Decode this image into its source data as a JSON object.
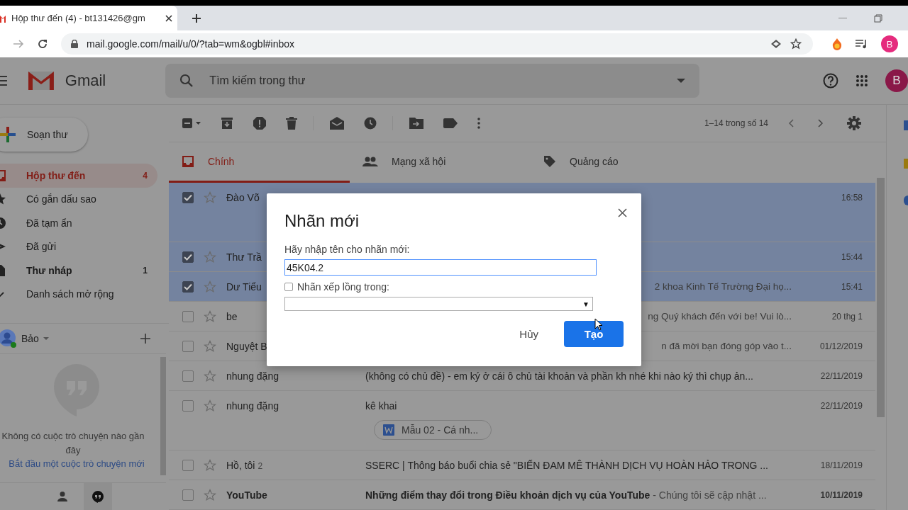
{
  "browser": {
    "tab_title": "Hộp thư đến (4) - bt131426@gm",
    "url": "mail.google.com/mail/u/0/?tab=wm&ogbl#inbox",
    "profile_initial": "B"
  },
  "header": {
    "app_name": "Gmail",
    "search_placeholder": "Tìm kiếm trong thư",
    "avatar_initial": "B"
  },
  "sidebar": {
    "compose": "Soạn thư",
    "items": [
      {
        "kind": "inbox",
        "label": "Hộp thư đến",
        "count": "4",
        "selected": true,
        "unread": true
      },
      {
        "kind": "star",
        "label": "Có gắn dấu sao",
        "selected": false,
        "unread": false
      },
      {
        "kind": "clock",
        "label": "Đã tạm ẩn",
        "selected": false,
        "unread": false
      },
      {
        "kind": "send",
        "label": "Đã gửi",
        "selected": false,
        "unread": false
      },
      {
        "kind": "draft",
        "label": "Thư nháp",
        "count": "1",
        "selected": false,
        "unread": true
      },
      {
        "kind": "more",
        "label": "Danh sách mở rộng",
        "selected": false,
        "unread": false
      }
    ],
    "hangouts": {
      "user": "Bảo",
      "online": true,
      "empty_text": "Không có cuộc trò chuyện nào gần đây",
      "start_link": "Bắt đầu một cuộc trò chuyện mới"
    }
  },
  "toolbar": {
    "pagination": "1–14 trong số 14"
  },
  "tabs": [
    {
      "kind": "inbox",
      "label": "Chính",
      "selected": true
    },
    {
      "kind": "people",
      "label": "Mạng xã hội",
      "selected": false
    },
    {
      "kind": "tag",
      "label": "Quảng cáo",
      "selected": false
    }
  ],
  "rows": [
    {
      "kind": "tall",
      "sender": "Đào Võ",
      "date": "16:58",
      "checked": true,
      "starred": false,
      "unread": false
    },
    {
      "kind": "plain",
      "sender": "Thư Trầ",
      "date": "15:44",
      "checked": true,
      "starred": false,
      "unread": false
    },
    {
      "kind": "plain",
      "sender": "Dư Tiểu",
      "snippet": "2 khoa Kinh Tế Trường Đại họ...",
      "date": "15:41",
      "checked": true,
      "starred": false,
      "unread": false
    },
    {
      "kind": "plain",
      "sender": "be",
      "snippet": "ng Quý khách đến với be! Vui lò...",
      "date": "20 thg 1",
      "checked": false,
      "starred": false,
      "unread": false
    },
    {
      "kind": "plain",
      "sender": "Nguyệt B",
      "snippet": "n đã mời bạn đóng góp vào t...",
      "date": "01/12/2019",
      "checked": false,
      "starred": false,
      "unread": false
    },
    {
      "kind": "plain",
      "sender": "nhung đặng",
      "subject": "(không có chủ đề) - em ký ở cái ô chủ tài khoản và phần kh nhé khi nào ký thì chụp ản...",
      "date": "22/11/2019",
      "checked": false,
      "starred": false,
      "unread": false
    },
    {
      "kind": "tall",
      "sender": "nhung đặng",
      "subject": "kê khai",
      "attachment": "Mẫu 02 - Cá nh...",
      "date": "22/11/2019",
      "checked": false,
      "starred": false,
      "unread": false
    },
    {
      "kind": "plain",
      "sender": "Hồ, tôi",
      "thread_count": "2",
      "subject": "SSERC | Thông báo buổi chia sẻ \"BIẾN ĐAM MÊ THÀNH DỊCH VỤ HOÀN HẢO TRONG ...",
      "date": "18/11/2019",
      "checked": false,
      "starred": false,
      "unread": false
    },
    {
      "kind": "plain",
      "sender": "YouTube",
      "subject": "Những điểm thay đổi trong Điều khoản dịch vụ của YouTube",
      "preview": " - Chúng tôi sẽ cập nhật ...",
      "date": "10/11/2019",
      "checked": false,
      "starred": false,
      "unread": true
    }
  ],
  "dialog": {
    "title": "Nhãn mới",
    "prompt": "Hãy nhập tên cho nhãn mới:",
    "value": "45K04.2",
    "nest_label": "Nhãn xếp lồng trong:",
    "nest_checked": false,
    "select_arrow": "▼",
    "cancel": "Hủy",
    "create": "Tạo"
  }
}
